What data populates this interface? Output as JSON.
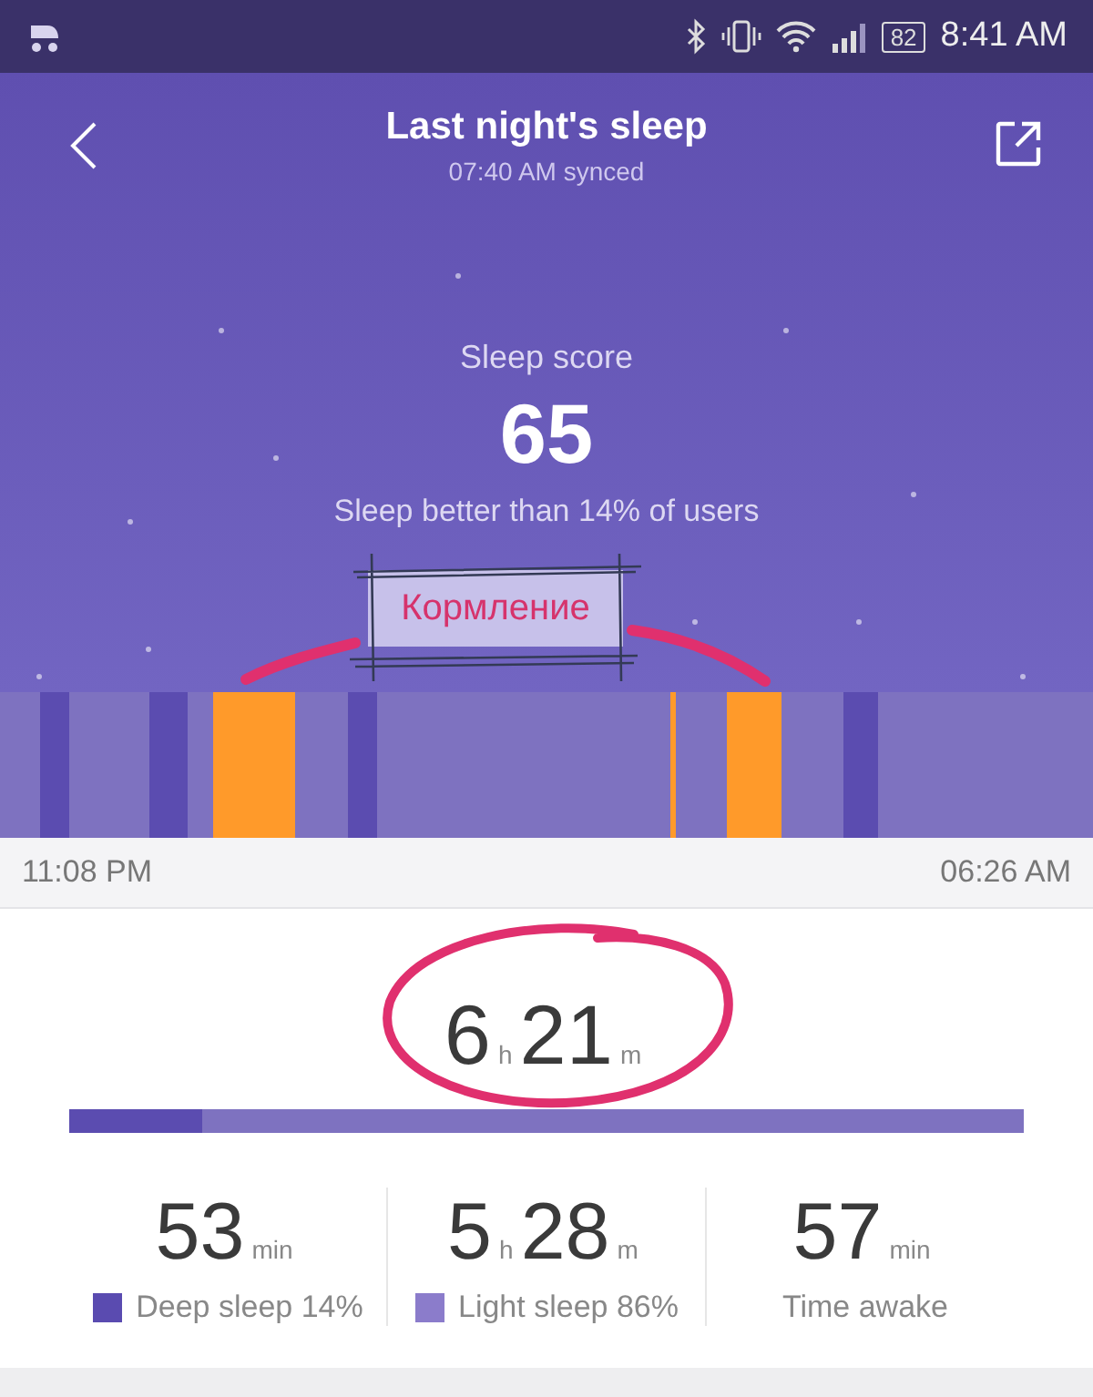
{
  "status_bar": {
    "time": "8:41 AM",
    "battery": "82"
  },
  "header": {
    "title": "Last night's sleep",
    "subtitle": "07:40 AM synced"
  },
  "score": {
    "label": "Sleep score",
    "value": "65",
    "comparison": "Sleep better than 14% of users"
  },
  "annotation": {
    "label": "Кормление"
  },
  "timeline": {
    "segments": [
      {
        "kind": "light"
      },
      {
        "kind": "deep"
      },
      {
        "kind": "light"
      },
      {
        "kind": "deep"
      },
      {
        "kind": "light"
      },
      {
        "kind": "awake"
      },
      {
        "kind": "light"
      },
      {
        "kind": "deep"
      },
      {
        "kind": "light"
      },
      {
        "kind": "awake"
      },
      {
        "kind": "light"
      },
      {
        "kind": "awake"
      },
      {
        "kind": "light"
      },
      {
        "kind": "deep"
      },
      {
        "kind": "light"
      }
    ],
    "start": "11:08 PM",
    "end": "06:26 AM"
  },
  "total": {
    "parts": [
      {
        "text": "6",
        "kind": "number"
      },
      {
        "text": "h",
        "kind": "unit"
      },
      {
        "text": "21",
        "kind": "number"
      },
      {
        "text": "m",
        "kind": "unit"
      }
    ],
    "level": 0.14
  },
  "stats": [
    {
      "parts": [
        {
          "text": "53",
          "kind": "number"
        },
        {
          "text": "min",
          "kind": "unit"
        }
      ],
      "label": "Deep sleep 14%",
      "color": "#5a4bb0"
    },
    {
      "parts": [
        {
          "text": "5",
          "kind": "number"
        },
        {
          "text": "h",
          "kind": "unit"
        },
        {
          "text": "28",
          "kind": "number"
        },
        {
          "text": "m",
          "kind": "unit"
        }
      ],
      "label": "Light sleep 86%",
      "color": "#8b7ccb"
    },
    {
      "parts": [
        {
          "text": "57",
          "kind": "number"
        },
        {
          "text": "min",
          "kind": "unit"
        }
      ],
      "label": "Time awake"
    }
  ]
}
